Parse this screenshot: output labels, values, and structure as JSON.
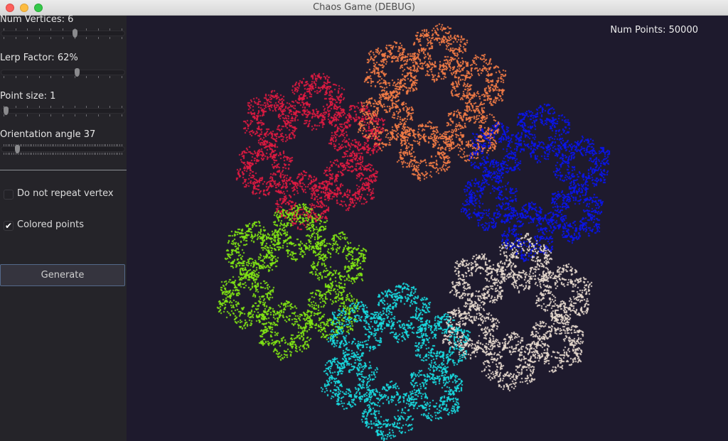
{
  "window": {
    "title": "Chaos Game (DEBUG)"
  },
  "controls": {
    "num_vertices": {
      "label": "Num Vertices: 6",
      "value": 6,
      "min": 3,
      "max": 10
    },
    "lerp_factor": {
      "label": "Lerp Factor: 62%",
      "value": 0.62
    },
    "point_size": {
      "label": "Point size: 1",
      "value": 1,
      "min": 1,
      "max": 5
    },
    "orientation_angle": {
      "label": "Orientation angle 37",
      "value": 37,
      "min": 0,
      "max": 360
    },
    "do_not_repeat_vertex": {
      "label": "Do not repeat vertex",
      "checked": false
    },
    "colored_points": {
      "label": "Colored points",
      "checked": true,
      "check_glyph": "✔"
    },
    "generate_button": {
      "label": "Generate"
    }
  },
  "canvas": {
    "num_points_label": "Num Points: 50000",
    "num_points": 50000,
    "background": "#1e1a2d",
    "vertex_colors": [
      "#ef7a45",
      "#0a14e8",
      "#e3d6cb",
      "#18d8dd",
      "#7fe214",
      "#dc1a40"
    ]
  }
}
